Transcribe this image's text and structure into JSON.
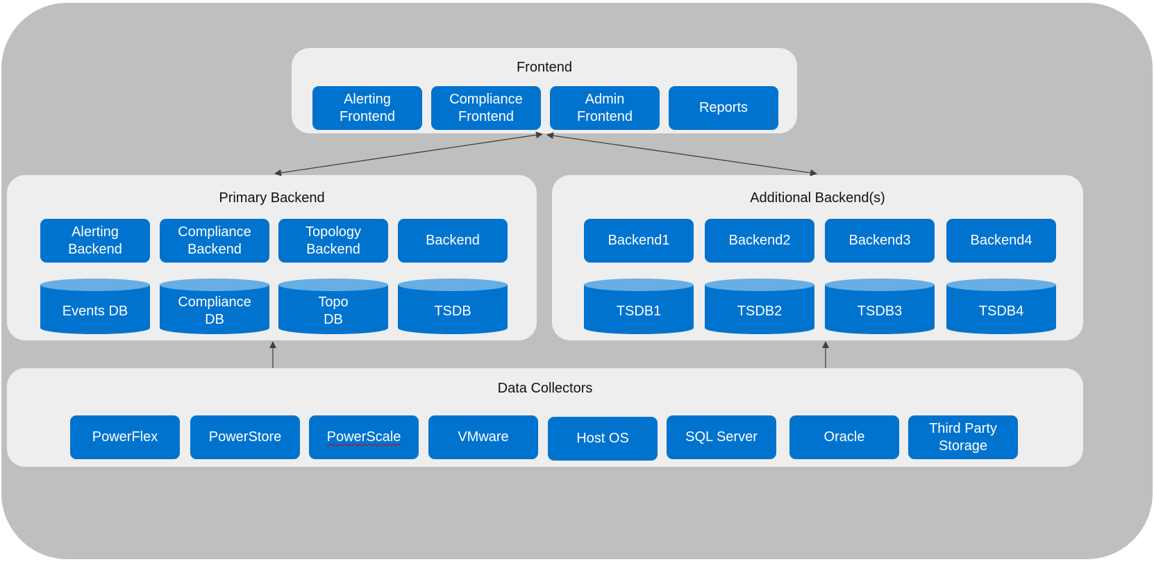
{
  "frontend": {
    "title": "Frontend",
    "items": [
      "Alerting\nFrontend",
      "Compliance\nFrontend",
      "Admin\nFrontend",
      "Reports"
    ]
  },
  "primary_backend": {
    "title": "Primary Backend",
    "services": [
      "Alerting\nBackend",
      "Compliance\nBackend",
      "Topology\nBackend",
      "Backend"
    ],
    "databases": [
      "Events DB",
      "Compliance\nDB",
      "Topo\nDB",
      "TSDB"
    ]
  },
  "additional_backends": {
    "title": "Additional Backend(s)",
    "services": [
      "Backend1",
      "Backend2",
      "Backend3",
      "Backend4"
    ],
    "databases": [
      "TSDB1",
      "TSDB2",
      "TSDB3",
      "TSDB4"
    ]
  },
  "data_collectors": {
    "title": "Data Collectors",
    "items": [
      "PowerFlex",
      "PowerStore",
      "PowerScale",
      "VMware",
      "Host OS",
      "SQL Server",
      "Oracle",
      "Third Party\nStorage"
    ]
  },
  "colors": {
    "background": "#bfbfbf",
    "panel": "#eeeeee",
    "box": "#0073cf",
    "db_top": "#66aee3",
    "arrow": "#404040"
  }
}
